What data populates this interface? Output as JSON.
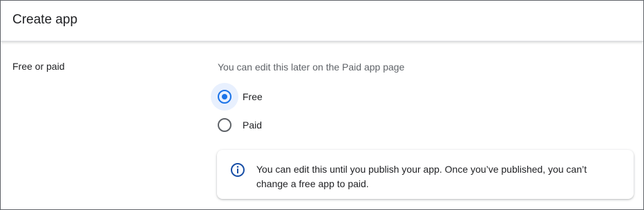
{
  "header": {
    "title": "Create app"
  },
  "free_or_paid": {
    "label": "Free or paid",
    "description": "You can edit this later on the Paid app page",
    "options": [
      {
        "label": "Free",
        "selected": true
      },
      {
        "label": "Paid",
        "selected": false
      }
    ],
    "info": {
      "icon": "info-icon",
      "text": "You can edit this until you publish your app. Once you’ve published, you can’t change a free app to paid."
    }
  },
  "colors": {
    "accent": "#1a73e8",
    "selected_halo": "#e8f0fe",
    "secondary_text": "#5f6368",
    "info_icon": "#174ea6"
  }
}
